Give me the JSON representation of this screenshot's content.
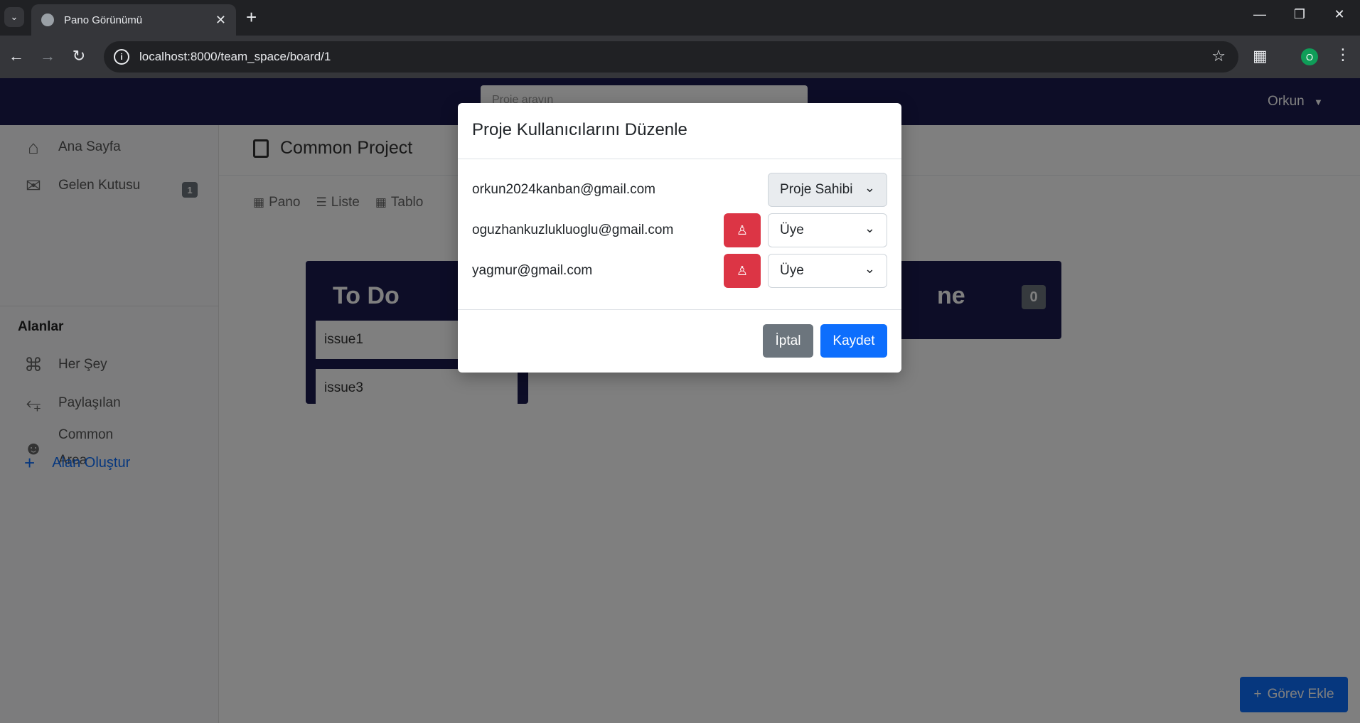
{
  "browser": {
    "tab_title": "Pano Görünümü",
    "url": "localhost:8000/team_space/board/1",
    "profile_initial": "O",
    "new_tab": "+",
    "tab_close": "✕"
  },
  "topnav": {
    "search_placeholder": "Proje arayın",
    "user_name": "Orkun"
  },
  "sidebar": {
    "items": [
      {
        "label": "Ana Sayfa",
        "icon": "home-icon"
      },
      {
        "label": "Gelen Kutusu",
        "icon": "inbox-icon",
        "badge": "1"
      }
    ],
    "section_title": "Alanlar",
    "areas": [
      {
        "label": "Her Şey",
        "icon": "command-icon"
      },
      {
        "label": "Paylaşılan",
        "icon": "share-icon"
      },
      {
        "label": "Common Area",
        "label_line1": "Common",
        "label_line2": "Area",
        "icon": "people-icon"
      }
    ],
    "create_label": "Alan Oluştur"
  },
  "main": {
    "project_title": "Common Project",
    "view_tabs": [
      "Pano",
      "Liste",
      "Tablo"
    ],
    "columns": [
      {
        "title": "To Do",
        "cards": [
          "issue1",
          "issue3"
        ]
      },
      {
        "title_partial": "ne",
        "count": "0"
      }
    ],
    "add_task_label": "Görev Ekle"
  },
  "modal": {
    "title": "Proje Kullanıcılarını Düzenle",
    "users": [
      {
        "email": "orkun2024kanban@gmail.com",
        "role": "Proje Sahibi"
      },
      {
        "email": "oguzhankuzlukluoglu@gmail.com",
        "role": "Üye"
      },
      {
        "email": "yagmur@gmail.com",
        "role": "Üye"
      }
    ],
    "cancel_label": "İptal",
    "save_label": "Kaydet"
  },
  "colors": {
    "navbar": "#1a1a4e",
    "primary": "#0d6efd",
    "danger": "#dc3545",
    "secondary": "#6c757d"
  }
}
